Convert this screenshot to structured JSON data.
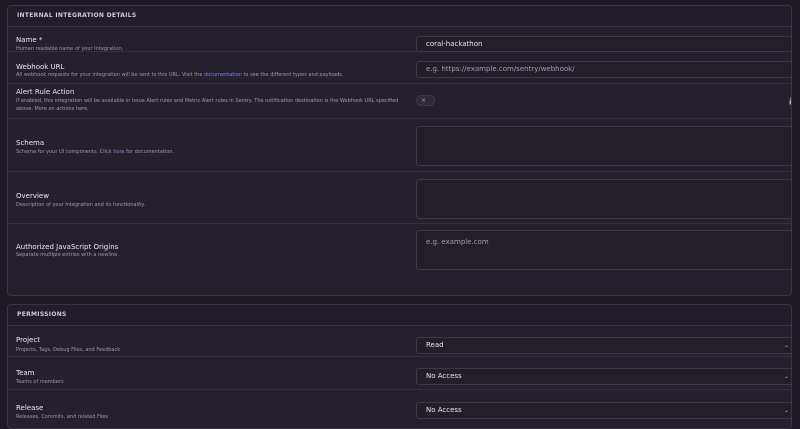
{
  "integration_panel": {
    "header": "Internal Integration Details",
    "name": {
      "label": "Name *",
      "help": "Human readable name of your Integration.",
      "value": "coral-hackathon"
    },
    "webhook": {
      "label": "Webhook URL",
      "help_before": "All webhook requests for your integration will be sent to this URL. Visit the ",
      "help_link": "documentation",
      "help_after": " to see the different types and payloads.",
      "placeholder": "e.g. https://example.com/sentry/webhook/"
    },
    "alert_rule": {
      "label": "Alert Rule Action",
      "help": "If enabled, this integration will be available in Issue Alert rules and Metric Alert rules in Sentry. The notification destination is the Webhook URL specified above. More on actions here.",
      "toggle_symbol": "×",
      "lock_icon": "lock-icon"
    },
    "schema": {
      "label": "Schema",
      "help_before": "Schema for your UI components. Click ",
      "help_link": "here",
      "help_after": " for documentation.",
      "value": ""
    },
    "overview": {
      "label": "Overview",
      "help": "Description of your Integration and its functionality.",
      "value": ""
    },
    "origins": {
      "label": "Authorized JavaScript Origins",
      "help": "Separate multiple entries with a newline.",
      "placeholder": "e.g. example.com"
    }
  },
  "permissions_panel": {
    "header": "Permissions",
    "rows": [
      {
        "label": "Project",
        "help": "Projects, Tags, Debug Files, and Feedback",
        "value": "Read"
      },
      {
        "label": "Team",
        "help": "Teams of members",
        "value": "No Access"
      },
      {
        "label": "Release",
        "help": "Releases, Commits, and related Files",
        "value": "No Access"
      }
    ],
    "chevron_icon": "chevron-down-icon"
  }
}
